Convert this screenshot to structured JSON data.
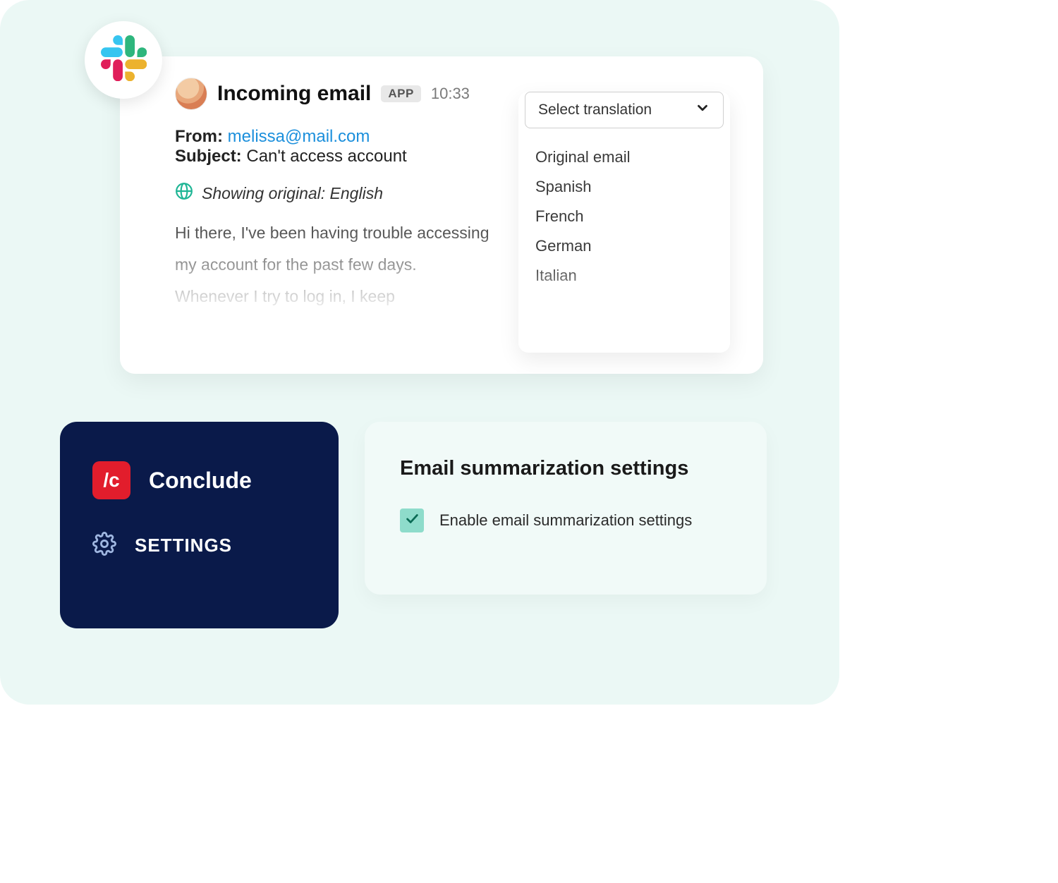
{
  "message": {
    "title": "Incoming email",
    "app_badge": "APP",
    "time": "10:33",
    "from_label": "From:",
    "from_email": "melissa@mail.com",
    "subject_label": "Subject:",
    "subject": "Can't access account",
    "showing_original": "Showing original: English",
    "body": "Hi there, I've been having trouble accessing my account for the past few days. Whenever I try to log in, I keep"
  },
  "translation": {
    "select_label": "Select translation",
    "options": [
      "Original email",
      "Spanish",
      "French",
      "German",
      "Italian"
    ]
  },
  "conclude": {
    "brand": "Conclude",
    "logo_text": "/c",
    "settings_label": "SETTINGS"
  },
  "settings": {
    "title": "Email summarization settings",
    "enable_label": "Enable email summarization settings",
    "enabled": true
  },
  "colors": {
    "canvas_bg": "#ebf8f5",
    "dark_card": "#0a1a4a",
    "accent_red": "#e21d2c",
    "check_bg": "#8edccb",
    "link": "#1b8fdc"
  }
}
